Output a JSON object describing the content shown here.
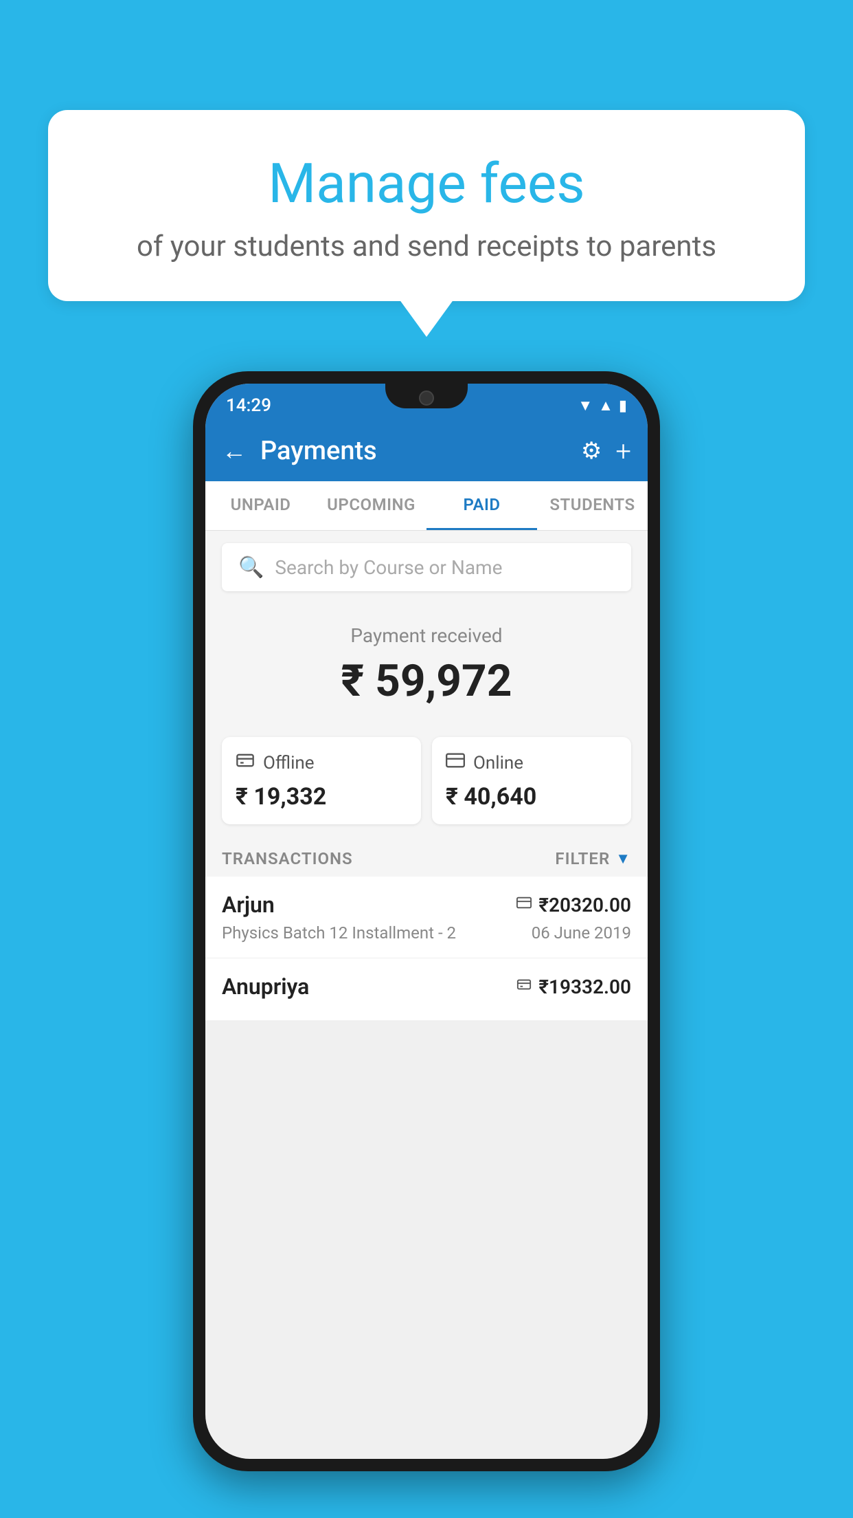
{
  "background_color": "#29b6e8",
  "speech_bubble": {
    "title": "Manage fees",
    "subtitle": "of your students and send receipts to parents"
  },
  "status_bar": {
    "time": "14:29",
    "wifi": "▲",
    "signal": "▲",
    "battery": "▮"
  },
  "header": {
    "title": "Payments",
    "back_label": "←",
    "plus_label": "+"
  },
  "tabs": [
    {
      "label": "UNPAID",
      "active": false
    },
    {
      "label": "UPCOMING",
      "active": false
    },
    {
      "label": "PAID",
      "active": true
    },
    {
      "label": "STUDENTS",
      "active": false
    }
  ],
  "search": {
    "placeholder": "Search by Course or Name"
  },
  "payment_section": {
    "label": "Payment received",
    "amount": "₹ 59,972"
  },
  "cards": [
    {
      "type": "Offline",
      "icon": "🪙",
      "amount": "₹ 19,332"
    },
    {
      "type": "Online",
      "icon": "💳",
      "amount": "₹ 40,640"
    }
  ],
  "transactions_header": {
    "label": "TRANSACTIONS",
    "filter_label": "FILTER"
  },
  "transactions": [
    {
      "name": "Arjun",
      "amount": "₹20320.00",
      "payment_type": "card",
      "course": "Physics Batch 12 Installment - 2",
      "date": "06 June 2019"
    },
    {
      "name": "Anupriya",
      "amount": "₹19332.00",
      "payment_type": "offline",
      "course": "",
      "date": ""
    }
  ]
}
